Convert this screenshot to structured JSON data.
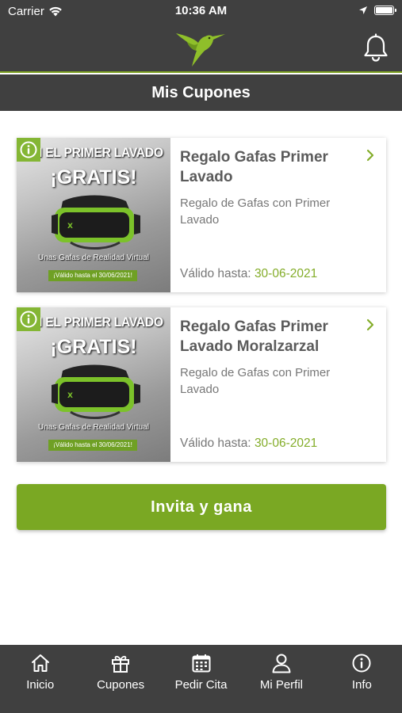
{
  "status_bar": {
    "carrier": "Carrier",
    "time": "10:36 AM"
  },
  "header": {
    "title": "Mis Cupones",
    "logo_icon": "hummingbird-logo",
    "notification_icon": "bell-icon",
    "accent_color": "#7ea322",
    "bar_color": "#404040"
  },
  "coupons": [
    {
      "title": "Regalo Gafas Primer Lavado",
      "description": "Regalo de Gafas con Primer Lavado",
      "valid_label": "Válido hasta:",
      "valid_date": "30-06-2021",
      "image": {
        "headline": "ON EL PRIMER LAVADO",
        "gratis": "¡GRATIS!",
        "subtitle": "Unas Gafas de Realidad Virtual",
        "valid_strip": "¡Válido hasta el 30/06/2021!"
      }
    },
    {
      "title": "Regalo Gafas Primer Lavado Moralzarzal",
      "description": "Regalo de Gafas con Primer Lavado",
      "valid_label": "Válido hasta:",
      "valid_date": "30-06-2021",
      "image": {
        "headline": "ON EL PRIMER LAVADO",
        "gratis": "¡GRATIS!",
        "subtitle": "Unas Gafas de Realidad Virtual",
        "valid_strip": "¡Válido hasta el 30/06/2021!"
      }
    }
  ],
  "invite_button": {
    "label": "Invita y gana",
    "color": "#7aa823"
  },
  "tabbar": {
    "items": [
      {
        "label": "Inicio",
        "icon": "home-icon"
      },
      {
        "label": "Cupones",
        "icon": "gift-icon"
      },
      {
        "label": "Pedir Cita",
        "icon": "calendar-icon"
      },
      {
        "label": "Mi Perfil",
        "icon": "user-icon"
      },
      {
        "label": "Info",
        "icon": "info-icon"
      }
    ]
  }
}
